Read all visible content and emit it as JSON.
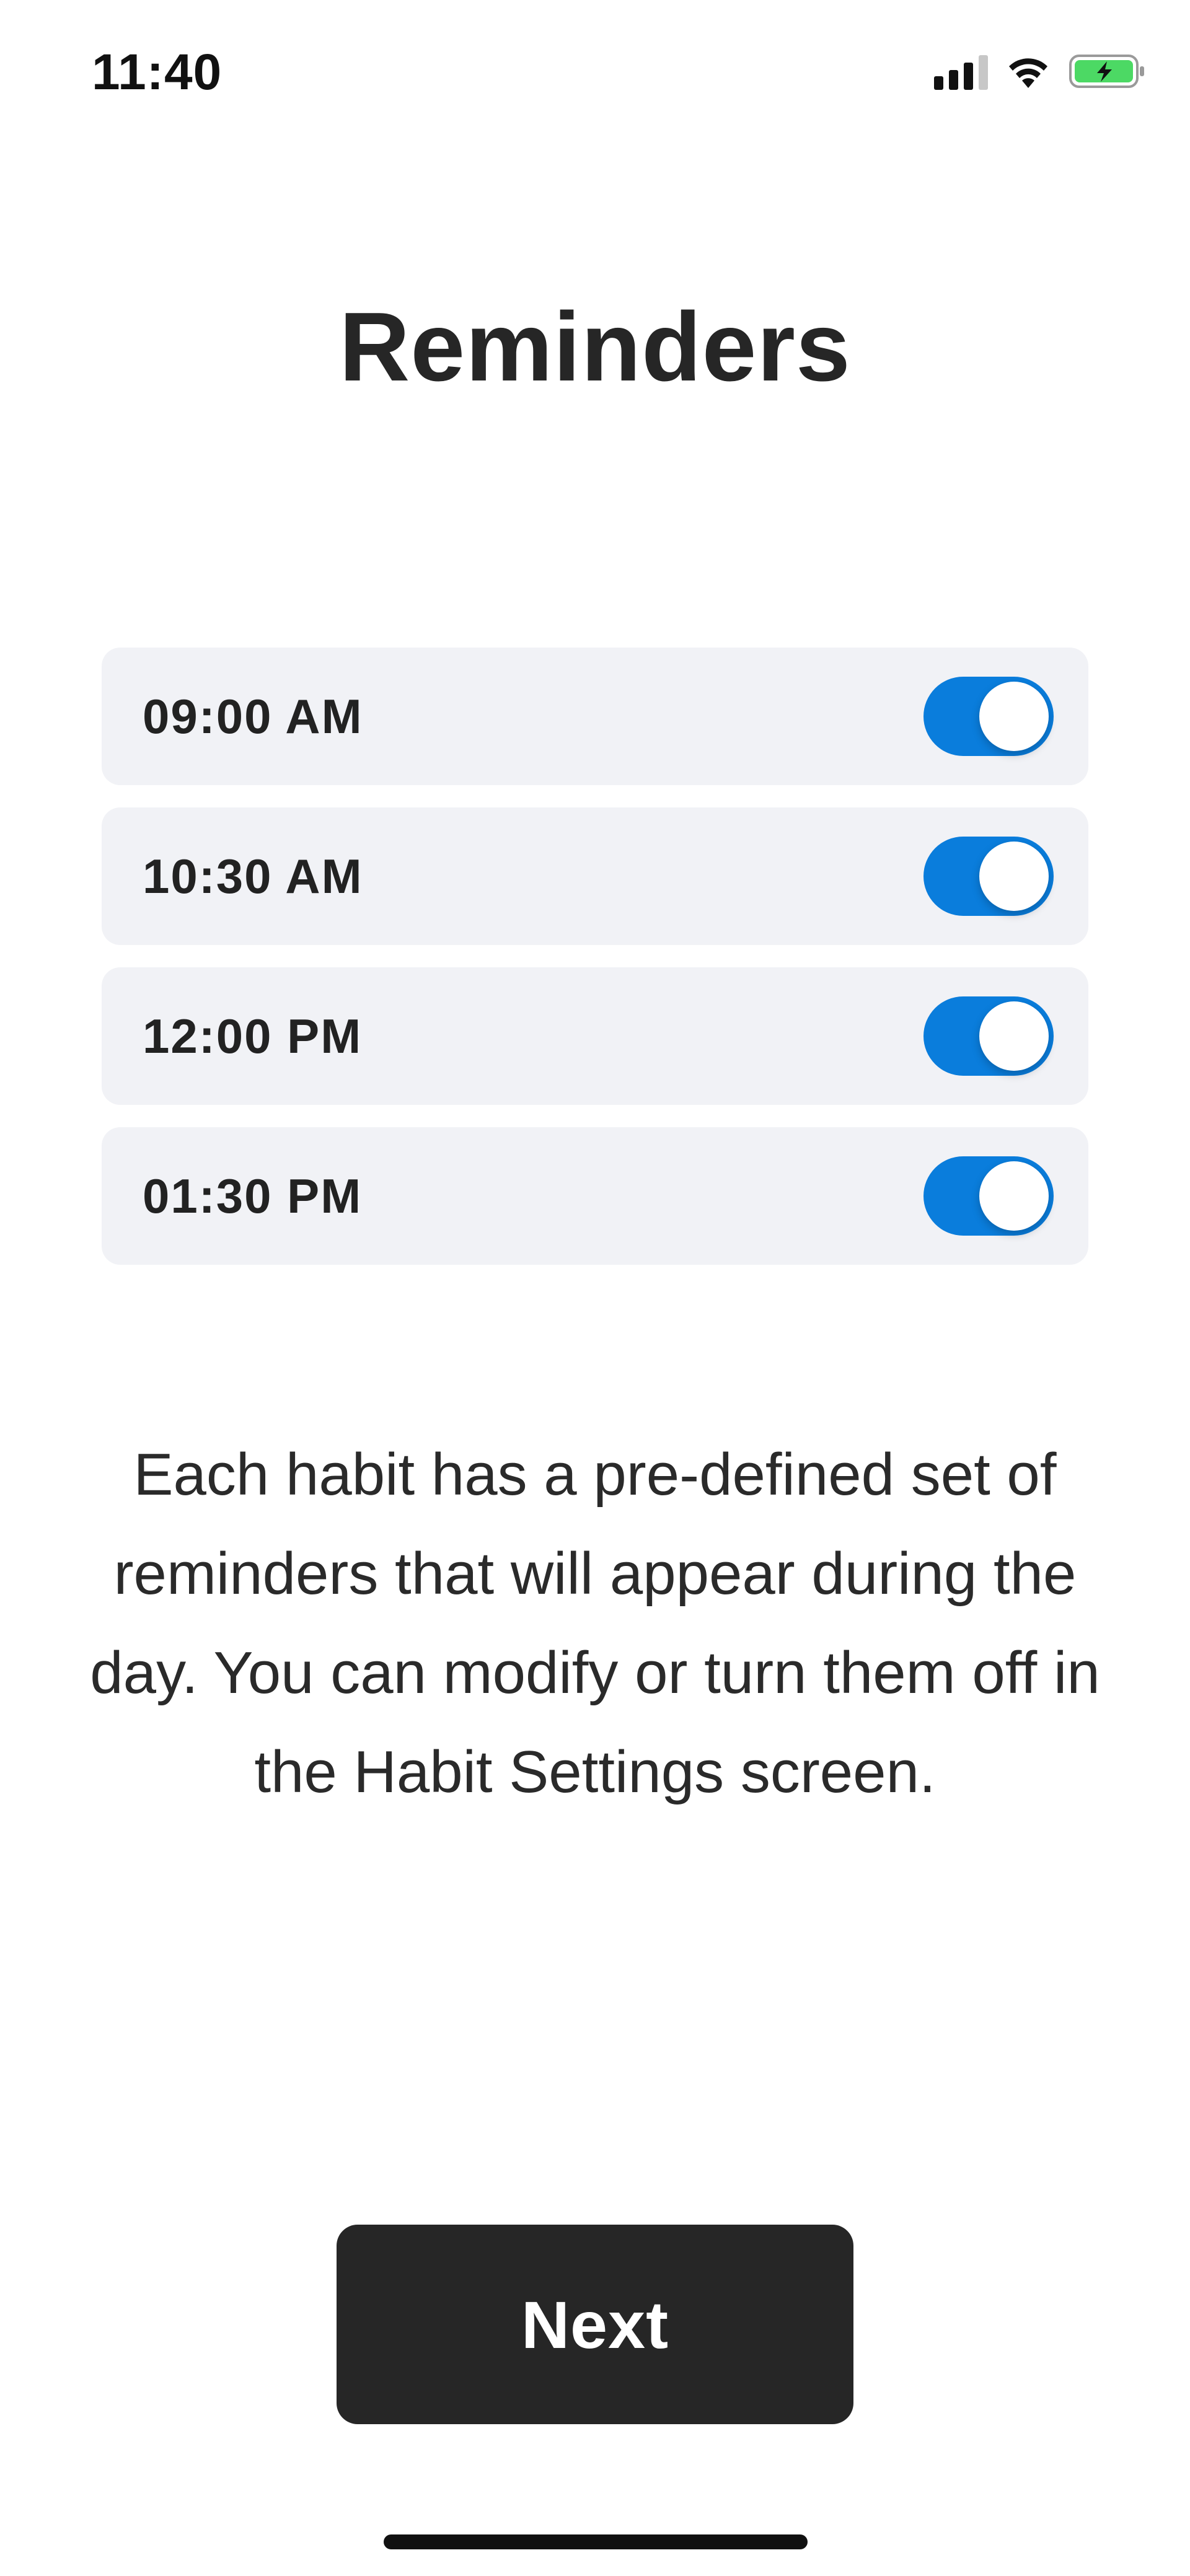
{
  "status_bar": {
    "time": "11:40",
    "icons": [
      "cellular-signal-icon",
      "wifi-icon",
      "battery-charging-icon"
    ],
    "battery_color": "#4cd964"
  },
  "title": "Reminders",
  "reminders": [
    {
      "time": "09:00 AM",
      "enabled": true
    },
    {
      "time": "10:30 AM",
      "enabled": true
    },
    {
      "time": "12:00 PM",
      "enabled": true
    },
    {
      "time": "01:30 PM",
      "enabled": true
    }
  ],
  "description": "Each habit has a pre-defined set of reminders that will appear during the day. You can modify or turn them off in the Habit Settings screen.",
  "next_button": {
    "label": "Next"
  },
  "colors": {
    "accent": "#0a7ddc",
    "row_background": "#f1f2f6",
    "button_background": "#262626"
  }
}
